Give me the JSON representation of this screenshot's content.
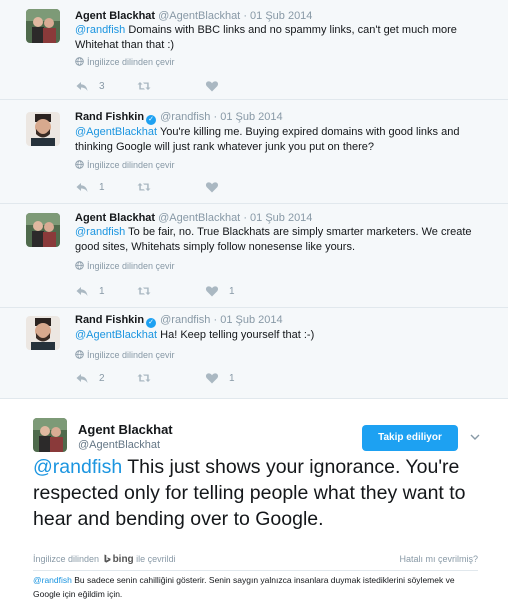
{
  "thread": [
    {
      "name": "Agent Blackhat",
      "verified": false,
      "handle": "@AgentBlackhat",
      "date": "· 01 Şub 2014",
      "mention": "@randfish",
      "text": " Domains with BBC links and no spammy links, can't get much more Whitehat than that :)",
      "translate": "İngilizce dilinden çevir",
      "reply_count": "3",
      "retweet_count": "",
      "like_count": ""
    },
    {
      "name": "Rand Fishkin",
      "verified": true,
      "handle": "@randfish",
      "date": "· 01 Şub 2014",
      "mention": "@AgentBlackhat",
      "text": " You're killing me. Buying expired domains with good links and thinking Google will just rank whatever junk you put on there?",
      "translate": "İngilizce dilinden çevir",
      "reply_count": "1",
      "retweet_count": "",
      "like_count": ""
    },
    {
      "name": "Agent Blackhat",
      "verified": false,
      "handle": "@AgentBlackhat",
      "date": "· 01 Şub 2014",
      "mention": "@randfish",
      "text": " To be fair, no. True Blackhats are simply smarter marketers. We create good sites, Whitehats simply follow nonesense like yours.",
      "translate": "İngilizce dilinden çevir",
      "reply_count": "1",
      "retweet_count": "",
      "like_count": "1"
    },
    {
      "name": "Rand Fishkin",
      "verified": true,
      "handle": "@randfish",
      "date": "· 01 Şub 2014",
      "mention": "@AgentBlackhat",
      "text": " Ha! Keep telling yourself that :-)",
      "translate": "İngilizce dilinden çevir",
      "reply_count": "2",
      "retweet_count": "",
      "like_count": "1"
    }
  ],
  "main": {
    "name": "Agent Blackhat",
    "handle": "@AgentBlackhat",
    "follow_label": "Takip ediliyor",
    "mention": "@randfish",
    "text": " This just shows your ignorance. You're respected only for telling people what they want to hear and bending over to Google.",
    "translated_from": "İngilizce dilinden",
    "bing_word": "bing",
    "translated_by": " ile çevrildi",
    "wrong_translation": "Hatalı mı çevrilmiş?",
    "translation_mention": "@randfish",
    "translation_text": " Bu sadece senin cahilliğini gösterir. Senin saygın yalnızca insanlara duymak istediklerini söylemek ve Google için eğildim için."
  },
  "colors": {
    "link": "#1b95e0",
    "follow_button": "#1da1f2",
    "muted": "#8899a6",
    "thread_bg": "#f5f8fa"
  }
}
